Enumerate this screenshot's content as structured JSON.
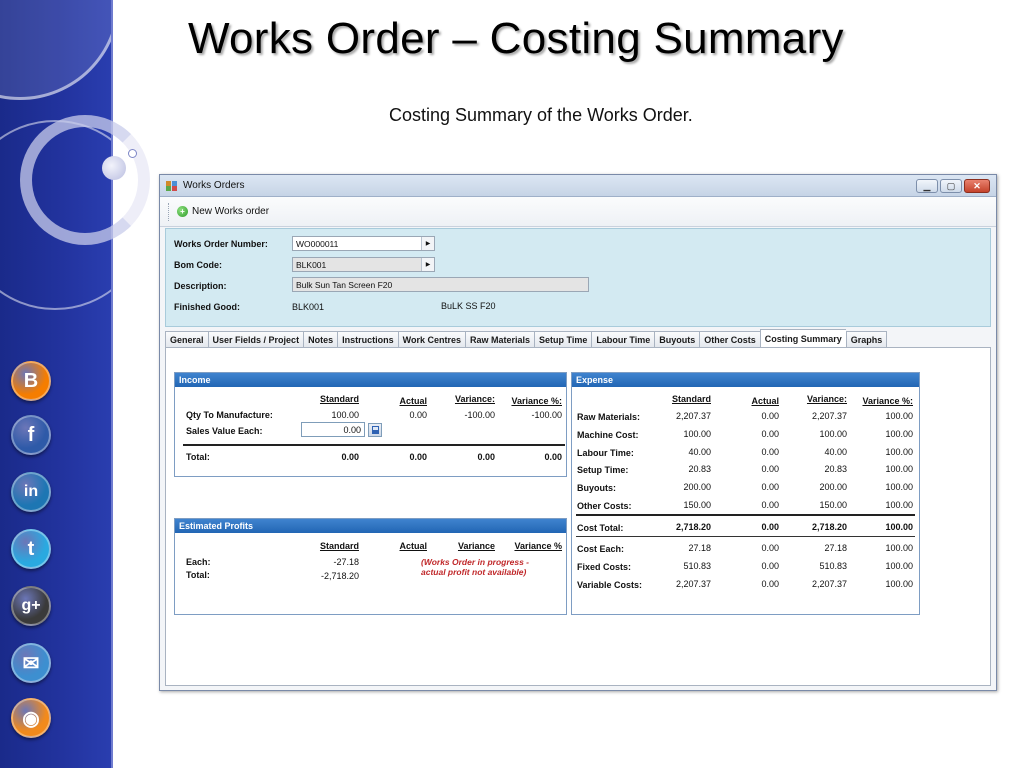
{
  "slide": {
    "title": "Works Order – Costing Summary",
    "subtitle": "Costing Summary of the Works Order.",
    "social_icons": [
      {
        "name": "blogger-icon",
        "glyph": "B",
        "color": "#f57d00"
      },
      {
        "name": "facebook-icon",
        "glyph": "f",
        "color": "#2e5aa8"
      },
      {
        "name": "linkedin-icon",
        "glyph": "in",
        "color": "#1d76b3"
      },
      {
        "name": "twitter-icon",
        "glyph": "t",
        "color": "#2aa9e0"
      },
      {
        "name": "google-plus-icon",
        "glyph": "g+",
        "color": "#3a3a3a"
      },
      {
        "name": "email-icon",
        "glyph": "✉",
        "color": "#3d8fd0"
      },
      {
        "name": "rss-icon",
        "glyph": "◉",
        "color": "#f28a1c"
      }
    ]
  },
  "window": {
    "title": "Works Orders",
    "toolbar": {
      "new_label": "New Works order"
    }
  },
  "header": {
    "works_order_label": "Works Order Number:",
    "works_order_value": "WO000011",
    "bom_label": "Bom Code:",
    "bom_value": "BLK001",
    "description_label": "Description:",
    "description_value": "Bulk Sun Tan Screen F20",
    "finished_good_label": "Finished Good:",
    "finished_good_code": "BLK001",
    "finished_good_desc": "BuLK SS F20"
  },
  "tabs": [
    "General",
    "User Fields / Project",
    "Notes",
    "Instructions",
    "Work Centres",
    "Raw Materials",
    "Setup Time",
    "Labour Time",
    "Buyouts",
    "Other Costs",
    "Costing Summary",
    "Graphs"
  ],
  "active_tab": "Costing Summary",
  "income": {
    "title": "Income",
    "columns": [
      "Standard",
      "Actual",
      "Variance:",
      "Variance %:"
    ],
    "qty_label": "Qty To Manufacture:",
    "qty": [
      "100.00",
      "0.00",
      "-100.00",
      "-100.00"
    ],
    "sales_label": "Sales Value Each:",
    "sales_value": "0.00",
    "total_label": "Total:",
    "total": [
      "0.00",
      "0.00",
      "0.00",
      "0.00"
    ]
  },
  "profits": {
    "title": "Estimated Profits",
    "columns": [
      "Standard",
      "Actual",
      "Variance",
      "Variance %"
    ],
    "each_label": "Each:",
    "each_standard": "-27.18",
    "total_label": "Total:",
    "total_standard": "-2,718.20",
    "note_line1": "(Works Order in progress -",
    "note_line2": "actual profit not available)"
  },
  "expense": {
    "title": "Expense",
    "columns": [
      "Standard",
      "Actual",
      "Variance:",
      "Variance %:"
    ],
    "rows": [
      {
        "label": "Raw Materials:",
        "values": [
          "2,207.37",
          "0.00",
          "2,207.37",
          "100.00"
        ]
      },
      {
        "label": "Machine Cost:",
        "values": [
          "100.00",
          "0.00",
          "100.00",
          "100.00"
        ]
      },
      {
        "label": "Labour Time:",
        "values": [
          "40.00",
          "0.00",
          "40.00",
          "100.00"
        ]
      },
      {
        "label": "Setup Time:",
        "values": [
          "20.83",
          "0.00",
          "20.83",
          "100.00"
        ]
      },
      {
        "label": "Buyouts:",
        "values": [
          "200.00",
          "0.00",
          "200.00",
          "100.00"
        ]
      },
      {
        "label": "Other Costs:",
        "values": [
          "150.00",
          "0.00",
          "150.00",
          "100.00"
        ]
      }
    ],
    "cost_total": {
      "label": "Cost Total:",
      "values": [
        "2,718.20",
        "0.00",
        "2,718.20",
        "100.00"
      ]
    },
    "rows2": [
      {
        "label": "Cost Each:",
        "values": [
          "27.18",
          "0.00",
          "27.18",
          "100.00"
        ]
      },
      {
        "label": "Fixed Costs:",
        "values": [
          "510.83",
          "0.00",
          "510.83",
          "100.00"
        ]
      },
      {
        "label": "Variable Costs:",
        "values": [
          "2,207.37",
          "0.00",
          "2,207.37",
          "100.00"
        ]
      }
    ]
  }
}
